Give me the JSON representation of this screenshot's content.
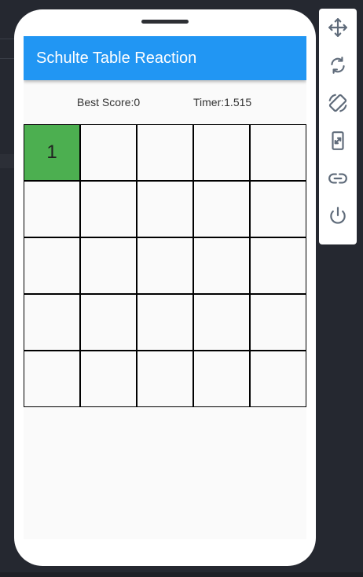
{
  "app": {
    "title": "Schulte Table Reaction"
  },
  "stats": {
    "best_score": "Best Score:0",
    "timer": "Timer:1.515"
  },
  "grid": {
    "cells": [
      "1",
      "",
      "",
      "",
      "",
      "",
      "",
      "",
      "",
      "",
      "",
      "",
      "",
      "",
      "",
      "",
      "",
      "",
      "",
      "",
      "",
      "",
      "",
      "",
      ""
    ],
    "highlighted_index": 0,
    "highlight_color": "#4caf50"
  },
  "colors": {
    "appbar": "#2196f3",
    "icon": "#5f6b7a"
  },
  "emulator_toolbar": {
    "icons": [
      "move-icon",
      "rotate-icon",
      "screen-rotation-icon",
      "resize-icon",
      "link-icon",
      "power-icon"
    ]
  }
}
